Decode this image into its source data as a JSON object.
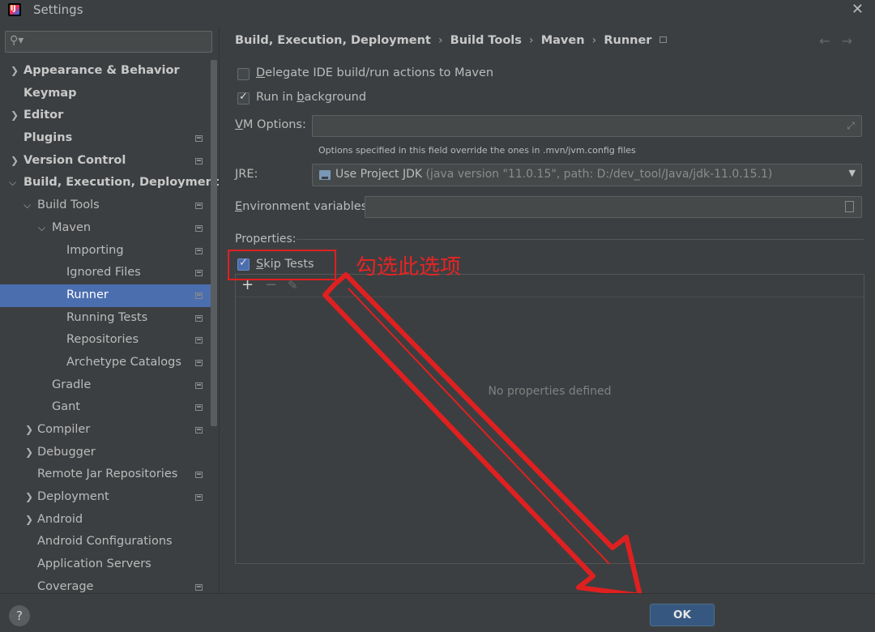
{
  "window": {
    "title": "Settings"
  },
  "search": {
    "placeholder": ""
  },
  "sidebar": {
    "items": [
      {
        "label": "Appearance & Behavior"
      },
      {
        "label": "Keymap"
      },
      {
        "label": "Editor"
      },
      {
        "label": "Plugins"
      },
      {
        "label": "Version Control"
      },
      {
        "label": "Build, Execution, Deployment"
      },
      {
        "label": "Build Tools"
      },
      {
        "label": "Maven"
      },
      {
        "label": "Importing"
      },
      {
        "label": "Ignored Files"
      },
      {
        "label": "Runner"
      },
      {
        "label": "Running Tests"
      },
      {
        "label": "Repositories"
      },
      {
        "label": "Archetype Catalogs"
      },
      {
        "label": "Gradle"
      },
      {
        "label": "Gant"
      },
      {
        "label": "Compiler"
      },
      {
        "label": "Debugger"
      },
      {
        "label": "Remote Jar Repositories"
      },
      {
        "label": "Deployment"
      },
      {
        "label": "Android"
      },
      {
        "label": "Android Configurations"
      },
      {
        "label": "Application Servers"
      },
      {
        "label": "Coverage"
      }
    ]
  },
  "breadcrumb": [
    "Build, Execution, Deployment",
    "Build Tools",
    "Maven",
    "Runner"
  ],
  "runner": {
    "delegate_pre": "D",
    "delegate_rest": "elegate IDE build/run actions to Maven",
    "delegate_checked": false,
    "background_pre": "Run in ",
    "background_b": "b",
    "background_rest": "ackground",
    "background_checked": true,
    "vm_label_u": "V",
    "vm_label_rest": "M Options:",
    "vm_value": "",
    "vm_hint": "Options specified in this field override the ones in .mvn/jvm.config files",
    "jre_label_u": "J",
    "jre_label_rest": "RE:",
    "jre_value": "Use Project JDK",
    "jre_detail": " (java version \"11.0.15\", path: D:/dev_tool/Java/jdk-11.0.15.1)",
    "env_label_u": "E",
    "env_label_rest": "nvironment variables:",
    "env_value": "",
    "properties_label": "Properties:",
    "skip_tests_s": "S",
    "skip_tests_rest": "kip Tests",
    "skip_tests_checked": true,
    "empty_text": "No properties defined"
  },
  "annotation": {
    "text": "勾选此选项",
    "color": "#e02020"
  },
  "footer": {
    "ok_label": "OK",
    "help_label": "?"
  },
  "colors": {
    "selected_row": "#4b6eaf",
    "background": "#3c3f41"
  }
}
